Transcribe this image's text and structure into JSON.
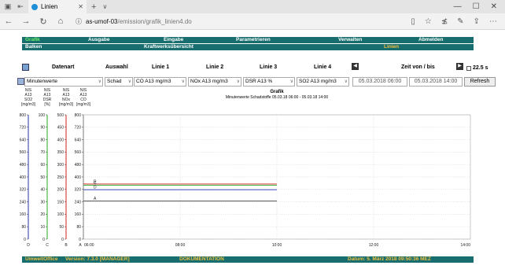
{
  "browser": {
    "tab_title": "Linien",
    "url_host": "as-umof-03",
    "url_path": "/emission/grafik_linien4.do"
  },
  "menu": {
    "row1": [
      "Grafik",
      "Ausgabe",
      "Eingabe",
      "Parametrieren",
      "Verwalten",
      "Abmelden"
    ],
    "row2": [
      "Balken",
      "Kraftwerksübersicht",
      "Linien"
    ]
  },
  "controls": {
    "datenart": "Datenart",
    "auswahl": "Auswahl",
    "linie1": "Linie 1",
    "linie2": "Linie 2",
    "linie3": "Linie 3",
    "linie4": "Linie 4",
    "zeit": "Zeit von / bis",
    "interval": "22.5 s",
    "datenart_value": "Minutenwerte",
    "auswahl_value": "Schad",
    "linie1_value": "CO A13 mg/m3",
    "linie2_value": "NOx A13 mg/m3",
    "linie3_value": "DSR A13 %",
    "linie4_value": "SO2 A13 mg/m3",
    "von": "05.03.2018 06:00",
    "bis": "05.03.2018 14:00",
    "refresh": "Refresh"
  },
  "footer": {
    "product": "UmweltOffice",
    "version": "Version: 7.3.0 [MANAGER]",
    "doc": "DOKUMENTATION",
    "date": "Datum: 5. März 2018 09:50:36 MEZ"
  },
  "colors": {
    "menu_bg": "#186e6e",
    "active": "#6cf26c",
    "highlight": "#f0c040"
  },
  "chart_data": {
    "type": "line",
    "title": "Grafik",
    "subtitle": "Minutenwerte Schadstoffe 05.03.18 06:00 - 05.03.18 14:00",
    "x_ticks": [
      "06:00",
      "08:00",
      "10:00",
      "12:00",
      "14:00"
    ],
    "axes": [
      {
        "head": [
          "NIS",
          "A13",
          "SO2",
          "[mg/m3]"
        ],
        "letter": "D",
        "ticks": [
          0,
          80,
          160,
          240,
          320,
          400,
          480,
          560,
          640,
          720,
          800
        ],
        "color": "#2233aa"
      },
      {
        "head": [
          "NIS",
          "A13",
          "DSR",
          "[%]"
        ],
        "letter": "C",
        "ticks": [
          0,
          10,
          20,
          30,
          40,
          50,
          60,
          70,
          80,
          90,
          100
        ],
        "color": "#22aa22"
      },
      {
        "head": [
          "NIS",
          "A13",
          "NOx",
          "[mg/m3]"
        ],
        "letter": "B",
        "ticks": [
          0,
          50,
          100,
          150,
          200,
          250,
          300,
          350,
          400,
          450,
          500
        ],
        "color": "#cc2222"
      },
      {
        "head": [
          "NIS",
          "A13",
          "CO",
          "[mg/m3]"
        ],
        "letter": "A",
        "ticks": [
          0,
          80,
          160,
          240,
          320,
          400,
          480,
          560,
          640,
          720,
          800
        ],
        "color": "#444444"
      }
    ],
    "series": [
      {
        "label": "A",
        "value": 245,
        "axis": 3,
        "color": "#555555",
        "x_end": "10:00"
      },
      {
        "label": "B",
        "value": 355,
        "axis": 3,
        "color": "#cc2222",
        "x_end": "10:00"
      },
      {
        "label": "C",
        "value": 347,
        "axis": 3,
        "color": "#22aa22",
        "x_end": "10:00"
      },
      {
        "label": "D",
        "value": 318,
        "axis": 3,
        "color": "#2233aa",
        "x_end": "10:00"
      }
    ]
  }
}
